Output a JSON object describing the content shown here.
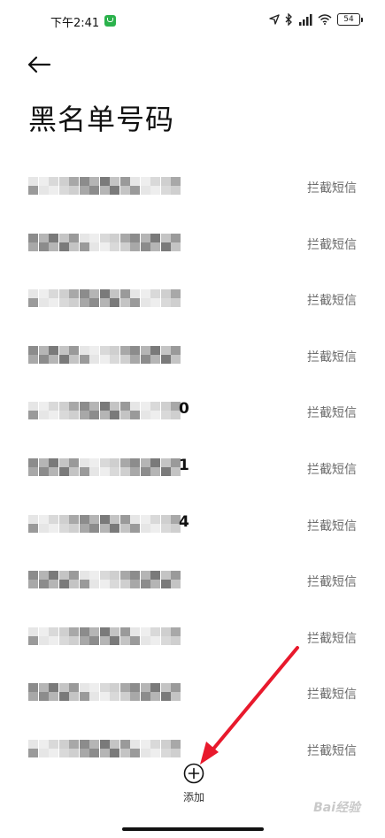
{
  "status_bar": {
    "time": "下午2:41",
    "battery_level": "54",
    "icons": [
      "wechat-icon",
      "location-icon",
      "bluetooth-icon",
      "signal-icon",
      "wifi-icon",
      "battery-icon"
    ]
  },
  "header": {
    "back_icon": "arrow-left-icon",
    "title": "黑名单号码"
  },
  "rows": [
    {
      "number": "",
      "action": "拦截短信"
    },
    {
      "number": "",
      "action": "拦截短信"
    },
    {
      "number": "",
      "action": "拦截短信"
    },
    {
      "number": "",
      "action": "拦截短信"
    },
    {
      "number": "",
      "visible_digit": "0",
      "action": "拦截短信"
    },
    {
      "number": "",
      "visible_digit": "1",
      "action": "拦截短信"
    },
    {
      "number": "",
      "visible_digit": "4",
      "action": "拦截短信"
    },
    {
      "number": "",
      "action": "拦截短信"
    },
    {
      "number": "",
      "action": "拦截短信"
    },
    {
      "number": "",
      "action": "拦截短信"
    },
    {
      "number": "",
      "action": "拦截短信"
    }
  ],
  "add": {
    "icon": "plus-circle-icon",
    "label": "添加"
  },
  "colors": {
    "accent_arrow": "#e8192c",
    "action_text": "#6b6b6b"
  }
}
